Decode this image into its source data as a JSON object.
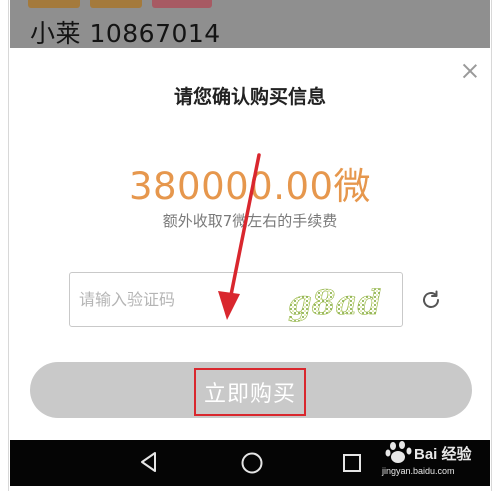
{
  "background_page": {
    "title": "小莱 10867014"
  },
  "dialog": {
    "title": "请您确认购买信息",
    "amount": "380000.00微",
    "fee_note": "额外收取7微左右的手续费",
    "code_input": {
      "placeholder": "请输入验证码",
      "value": ""
    },
    "captcha_text": "g8ad",
    "buy_button_label": "立即购买"
  },
  "watermark": {
    "brand": "Bai 经验",
    "url": "jingyan.baidu.com"
  },
  "colors": {
    "amount": "#e6974d",
    "annotation_red": "#d9272e",
    "button_bg": "#c9c9c9",
    "captcha_green": "#9ab94a"
  },
  "icons": {
    "close": "close-icon",
    "refresh": "refresh-icon",
    "back": "back-triangle-icon",
    "home": "home-circle-icon",
    "recent": "recent-square-icon"
  }
}
